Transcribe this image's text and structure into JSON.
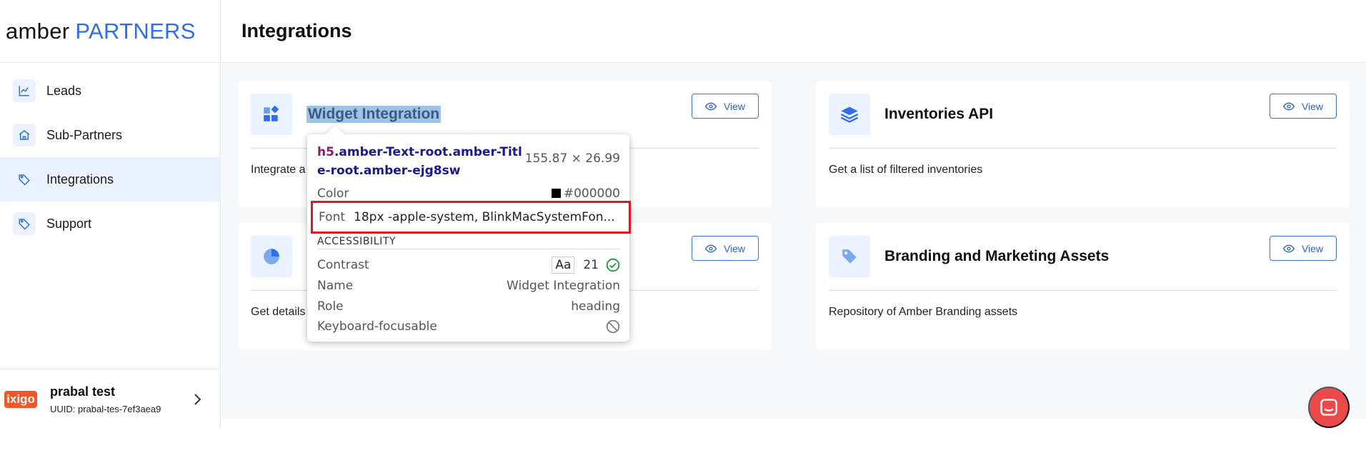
{
  "brand": {
    "name_a": "amber",
    "name_b": "PARTNERS"
  },
  "nav": [
    {
      "label": "Leads",
      "icon": "chart-line-icon"
    },
    {
      "label": "Sub-Partners",
      "icon": "home-icon"
    },
    {
      "label": "Integrations",
      "icon": "tag-icon",
      "active": true
    },
    {
      "label": "Support",
      "icon": "tag-icon"
    }
  ],
  "user": {
    "badge": "ixigo",
    "name": "prabal test",
    "uuid": "UUID: prabal-tes-7ef3aea9"
  },
  "page": {
    "title": "Integrations"
  },
  "cards": [
    {
      "title": "Widget Integration",
      "desc": "Integrate a",
      "view": "View",
      "icon": "widget-grid-icon"
    },
    {
      "title": "Inventories API",
      "desc": "Get a list of filtered inventories",
      "view": "View",
      "icon": "layers-icon"
    },
    {
      "title": "",
      "desc": "Get details",
      "view": "View",
      "icon": "pie-chart-icon"
    },
    {
      "title": "Branding and Marketing Assets",
      "desc": "Repository of Amber Branding assets",
      "view": "View",
      "icon": "price-tag-icon"
    }
  ],
  "inspector": {
    "tag": "h5",
    "selector_line1": ".amber-Text-root.amber-Titl",
    "selector_line2": "e-root.amber-ejg8sw",
    "size": "155.87 × 26.99",
    "color_label": "Color",
    "color_value": "#000000",
    "font_label": "Font",
    "font_value": "18px -apple-system, BlinkMacSystemFon...",
    "section": "ACCESSIBILITY",
    "contrast_label": "Contrast",
    "contrast_aa": "Aa",
    "contrast_value": "21",
    "name_label": "Name",
    "name_value": "Widget Integration",
    "role_label": "Role",
    "role_value": "heading",
    "keyboard_label": "Keyboard-focusable"
  },
  "colors": {
    "accent": "#2f6fea",
    "highlight_red": "#d91c23",
    "help": "#ec4a4a"
  }
}
